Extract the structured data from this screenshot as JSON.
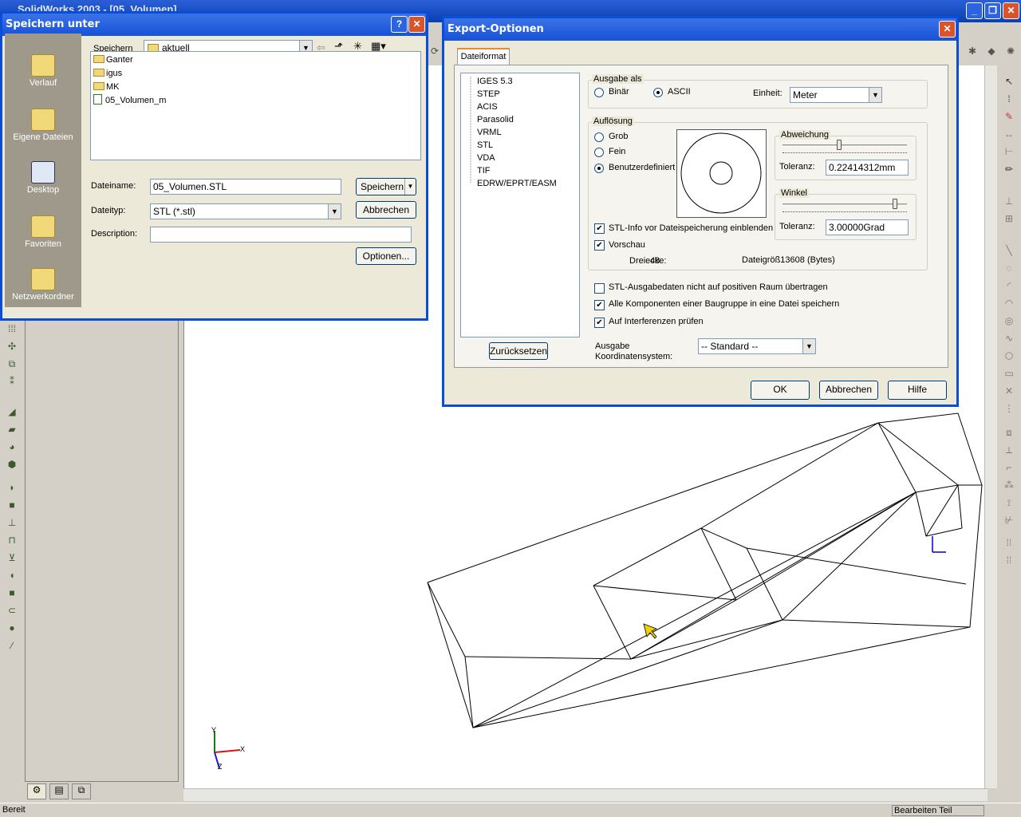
{
  "app": {
    "title": "SolidWorks 2003 - [05_Volumen]",
    "status_left": "Bereit",
    "status_right": "Bearbeiten Teil",
    "window_buttons": [
      "minimize-icon",
      "restore-icon",
      "close-icon"
    ]
  },
  "axis_labels": {
    "x": "X",
    "y": "Y",
    "z": "Z"
  },
  "save_dialog": {
    "title": "Speichern unter",
    "help_glyph": "?",
    "close_glyph": "✕",
    "save_in_label": "Speichern",
    "save_in_value": "aktuell",
    "places": [
      "Verlauf",
      "Eigene Dateien",
      "Desktop",
      "Favoriten",
      "Netzwerkordner"
    ],
    "files": [
      {
        "name": "Ganter",
        "type": "folder"
      },
      {
        "name": "igus",
        "type": "folder"
      },
      {
        "name": "MK",
        "type": "folder"
      },
      {
        "name": "05_Volumen_m",
        "type": "file"
      }
    ],
    "filename_label": "Dateiname:",
    "filename_value": "05_Volumen.STL",
    "filetype_label": "Dateityp:",
    "filetype_value": "STL (*.stl)",
    "description_label": "Description:",
    "description_value": "",
    "save_button": "Speichern",
    "cancel_button": "Abbrechen",
    "options_button": "Optionen..."
  },
  "export_dialog": {
    "title": "Export-Optionen",
    "close_glyph": "✕",
    "tab": "Dateiformat",
    "formats": [
      "IGES 5.3",
      "STEP",
      "ACIS",
      "Parasolid",
      "VRML",
      "STL",
      "VDA",
      "TIF",
      "EDRW/EPRT/EASM"
    ],
    "selected_format": "STL",
    "reset_button": "Zurücksetzen",
    "output_group": "Ausgabe als",
    "output_options": [
      "Binär",
      "ASCII"
    ],
    "output_selected": "ASCII",
    "unit_label": "Einheit:",
    "unit_value": "Meter",
    "resolution_group": "Auflösung",
    "resolution_options": [
      "Grob",
      "Fein",
      "Benutzerdefiniert"
    ],
    "resolution_selected": "Benutzerdefiniert",
    "deviation_group": "Abweichung",
    "deviation_tol_label": "Toleranz:",
    "deviation_tol_value": "0.22414312mm",
    "angle_group": "Winkel",
    "angle_tol_label": "Toleranz:",
    "angle_tol_value": "3.00000Grad",
    "deviation_slider_fraction": 0.45,
    "angle_slider_fraction": 0.92,
    "show_info_label": "STL-Info vor Dateispeicherung einblenden",
    "show_info_checked": true,
    "preview_label": "Vorschau",
    "preview_checked": true,
    "triangles_label": "Dreiecke:",
    "triangles_value": "48",
    "filesize_text": "Dateigröß13608 (Bytes)",
    "opt_positive_label": "STL-Ausgabedaten nicht auf positiven Raum übertragen",
    "opt_positive_checked": false,
    "opt_components_label": "Alle Komponenten einer Baugruppe in eine Datei speichern",
    "opt_components_checked": true,
    "opt_interference_label": "Auf Interferenzen prüfen",
    "opt_interference_checked": true,
    "coord_label_1": "Ausgabe",
    "coord_label_2": "Koordinatensystem:",
    "coord_value": "-- Standard --",
    "ok_button": "OK",
    "cancel_button": "Abbrechen",
    "help_button": "Hilfe"
  }
}
